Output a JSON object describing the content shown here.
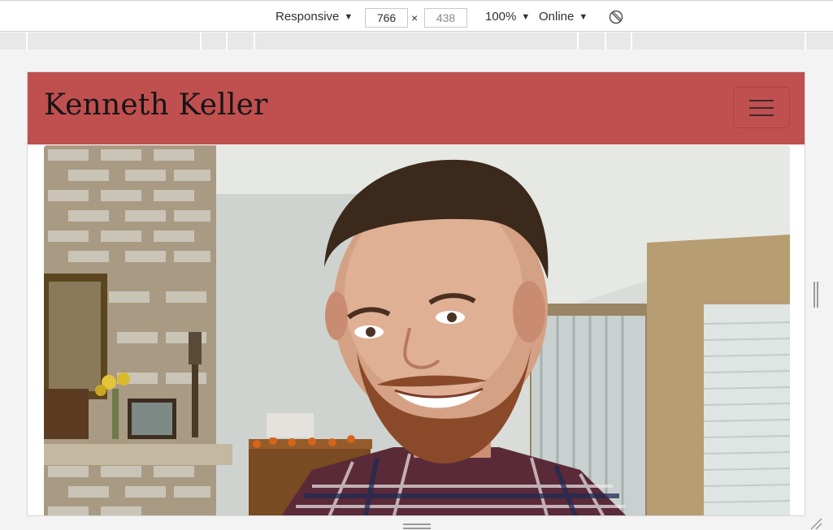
{
  "devtools": {
    "device_mode": "Responsive",
    "width_value": "766",
    "height_value": "438",
    "times_symbol": "×",
    "zoom": "100%",
    "network": "Online",
    "dropdown_arrow": "▼"
  },
  "site": {
    "brand": "Kenneth Keller",
    "menu_icon": "hamburger-icon",
    "hero_image": "portrait-photo"
  },
  "colors": {
    "navbar": "#c04f50",
    "brand_text": "#151515"
  }
}
